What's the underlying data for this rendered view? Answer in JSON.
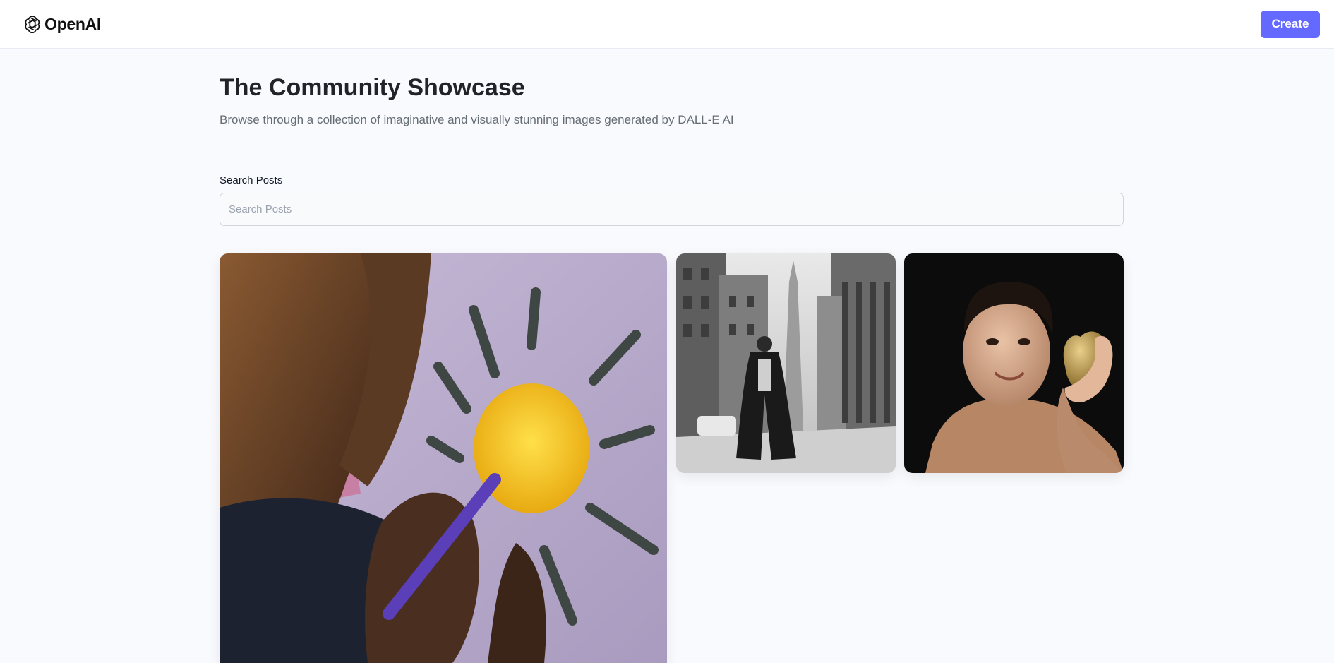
{
  "header": {
    "logo_text": "OpenAI",
    "create_label": "Create"
  },
  "main": {
    "title": "The Community Showcase",
    "subtitle": "Browse through a collection of imaginative and visually stunning images generated by DALL-E AI"
  },
  "search": {
    "label": "Search Posts",
    "placeholder": "Search Posts",
    "value": ""
  },
  "colors": {
    "accent": "#6469ff",
    "background": "#f9fafe",
    "title": "#222328",
    "subtitle": "#666e75"
  }
}
